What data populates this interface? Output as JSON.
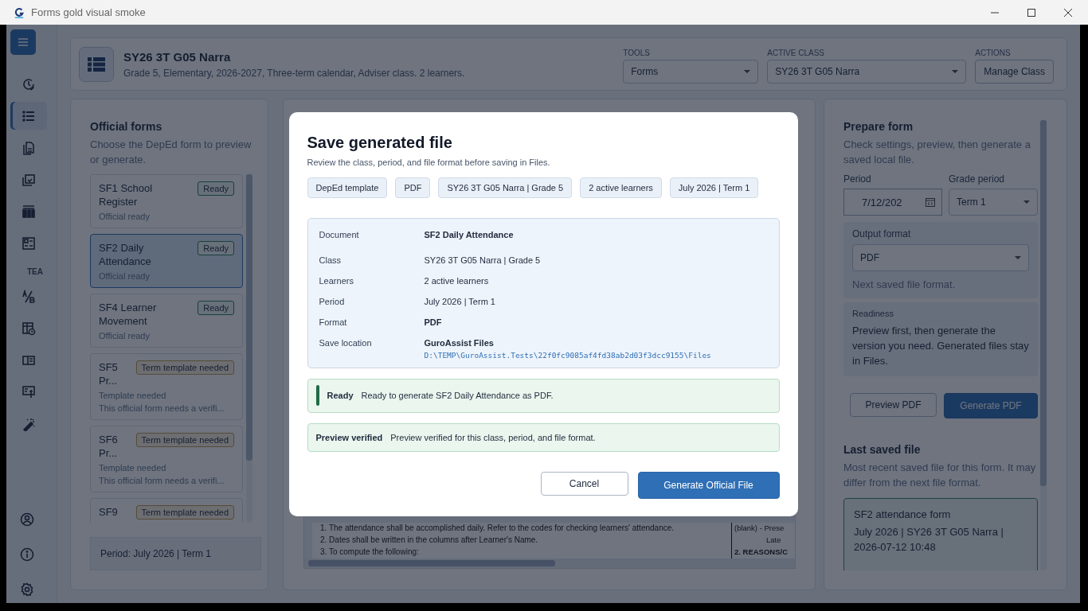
{
  "window": {
    "title": "Forms gold visual smoke"
  },
  "nav": {
    "items": [
      {
        "selected": false
      },
      {
        "selected": true
      },
      {
        "selected": false
      },
      {
        "selected": false
      },
      {
        "selected": false
      },
      {
        "selected": false
      }
    ],
    "section_label": "TEA",
    "section_items": [
      {
        "selected": false
      },
      {
        "selected": false
      },
      {
        "selected": false
      },
      {
        "selected": false
      },
      {
        "selected": false
      }
    ],
    "bottom_items": [
      {
        "selected": false
      },
      {
        "selected": false
      },
      {
        "selected": false
      }
    ]
  },
  "header": {
    "title": "SY26 3T G05 Narra",
    "subtitle": "Grade 5, Elementary, 2026-2027, Three-term calendar, Adviser class. 2 learners.",
    "tools": {
      "label": "TOOLS",
      "value": "Forms"
    },
    "active_class": {
      "label": "ACTIVE CLASS",
      "value": "SY26 3T G05 Narra"
    },
    "actions": {
      "label": "ACTIONS",
      "button": "Manage Class"
    }
  },
  "forms_panel": {
    "title": "Official forms",
    "subtitle": "Choose the DepEd form to preview or generate.",
    "forms": [
      {
        "title": "SF1 School Register",
        "badge": "Ready",
        "kind": "ready",
        "status": "Official ready",
        "selected": false
      },
      {
        "title": "SF2 Daily Attendance",
        "badge": "Ready",
        "kind": "ready",
        "status": "Official ready",
        "selected": true
      },
      {
        "title": "SF4 Learner Movement",
        "badge": "Ready",
        "kind": "ready",
        "status": "Official ready",
        "selected": false
      },
      {
        "title": "SF5 Pr...",
        "badge": "Term template needed",
        "kind": "needed",
        "status": "Template needed",
        "note": "This official form needs a verifi...",
        "selected": false
      },
      {
        "title": "SF6 Pr...",
        "badge": "Term template needed",
        "kind": "needed",
        "status": "Template needed",
        "note": "This official form needs a verifi...",
        "selected": false
      },
      {
        "title": "SF9",
        "badge": "Term template needed",
        "kind": "needed",
        "selected": false
      }
    ],
    "period": "Period: July 2026 | Term 1"
  },
  "preview": {
    "lines": [
      "1. The attendance shall be accomplished daily. Refer to the codes for checking learners' attendance.",
      "2. Dates shall be written in the columns after Learner's Name.",
      "3. To compute the following:"
    ],
    "side_lines": [
      {
        "text": "(blank) - Prese",
        "kind": "plain"
      },
      {
        "text": "Late",
        "kind": "indent"
      },
      {
        "text": "2. REASONS/C",
        "kind": "heading"
      }
    ]
  },
  "prepare": {
    "title": "Prepare form",
    "subtitle": "Check settings, preview, then generate a saved local file.",
    "period": {
      "label": "Period",
      "value": "7/12/202"
    },
    "grade_period": {
      "label": "Grade period",
      "value": "Term 1"
    },
    "output": {
      "label": "Output format",
      "value": "PDF",
      "hint": "Next saved file format."
    },
    "readiness": {
      "label": "Readiness",
      "text": "Preview first, then generate the version you need. Generated files stay in Files."
    },
    "buttons": [
      {
        "label": "Preview PDF",
        "kind": "secondary"
      },
      {
        "label": "Generate PDF",
        "kind": "primary"
      }
    ],
    "last_saved": {
      "title": "Last saved file",
      "subtitle": "Most recent saved file for this form. It may differ from the next file format.",
      "card_title": "SF2 attendance form",
      "card_text": "July 2026 | SY26 3T G05 Narra | 2026-07-12 10:48"
    }
  },
  "dialog": {
    "title": "Save generated file",
    "subtitle": "Review the class, period, and file format before saving in Files.",
    "chips": [
      "DepEd template",
      "PDF",
      "SY26 3T G05 Narra | Grade 5",
      "2 active learners",
      "July 2026 | Term 1"
    ],
    "details": [
      {
        "label": "Document",
        "value": "SF2 Daily Attendance",
        "emphasis": true
      },
      {
        "label": "Class",
        "value": "SY26 3T G05 Narra | Grade 5",
        "emphasis": false
      },
      {
        "label": "Learners",
        "value": "2 active learners",
        "emphasis": false
      },
      {
        "label": "Period",
        "value": "July 2026 | Term 1",
        "emphasis": false
      },
      {
        "label": "Format",
        "value": "PDF",
        "emphasis": true
      },
      {
        "label": "Save location",
        "value": "GuroAssist Files",
        "emphasis": true,
        "path": "D:\\TEMP\\GuroAssist.Tests\\22f0fc9085af4fd38ab2d03f3dcc9155\\Files"
      }
    ],
    "notices": [
      {
        "kind": "ready",
        "label": "Ready",
        "text": "Ready to generate SF2 Daily Attendance as PDF."
      },
      {
        "kind": "verified",
        "label": "Preview verified",
        "text": "Preview verified for this class, period, and file format."
      }
    ],
    "buttons": [
      {
        "label": "Cancel",
        "kind": "secondary"
      },
      {
        "label": "Generate Official File",
        "kind": "primary"
      }
    ]
  }
}
